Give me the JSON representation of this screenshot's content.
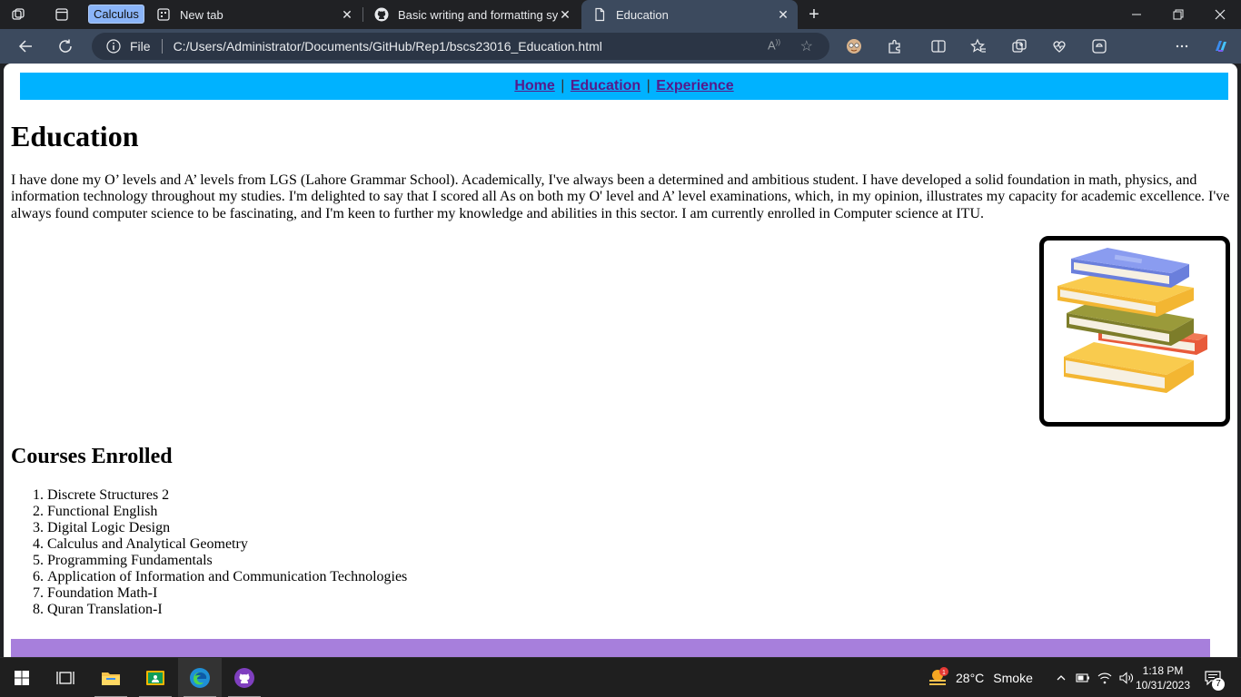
{
  "tabs": [
    {
      "label": "New tab",
      "icon": "new-tab-page-icon"
    },
    {
      "label": "Basic writing and formatting synt",
      "icon": "github-icon"
    },
    {
      "label": "Education",
      "icon": "document-icon"
    }
  ],
  "calc_chip": "Calculus",
  "address_bar": {
    "scheme": "File",
    "url": "C:/Users/Administrator/Documents/GitHub/Rep1/bscs23016_Education.html"
  },
  "page": {
    "nav": {
      "links": [
        "Home",
        "Education",
        "Experience"
      ],
      "separator": "|"
    },
    "heading": "Education",
    "intro": "I have done my O’ levels and A’ levels from LGS (Lahore Grammar School). Academically, I've always been a determined and ambitious student. I have developed a solid foundation in math, physics, and information technology throughout my studies. I'm delighted to say that I scored all As on both my O' level and A’ level examinations, which, in my opinion, illustrates my capacity for academic excellence. I've always found computer science to be fascinating, and I'm keen to further my knowledge and abilities in this sector. I am currently enrolled in Computer science at ITU.",
    "courses_heading": "Courses Enrolled",
    "courses": [
      {
        "num": "1.",
        "name": "Discrete Structures 2"
      },
      {
        "num": "2.",
        "name": "Functional English"
      },
      {
        "num": "3.",
        "name": "Digital Logic Design"
      },
      {
        "num": "4.",
        "name": "Calculus and Analytical Geometry"
      },
      {
        "num": "5.",
        "name": "Programming Fundamentals"
      },
      {
        "num": "6.",
        "name": "Application of Information and Communication Technologies"
      },
      {
        "num": "7.",
        "name": "Foundation Math-I"
      },
      {
        "num": "8.",
        "name": "Quran Translation-I"
      }
    ],
    "colors": {
      "nav_bg": "#00b2ff",
      "footer_bg": "#a77fdc",
      "link": "#551a8b"
    }
  },
  "taskbar": {
    "weather": {
      "temp": "28°C",
      "condition": "Smoke",
      "alert_count": "1"
    },
    "clock": {
      "time": "1:18 PM",
      "date": "10/31/2023"
    },
    "notifications": "7"
  }
}
